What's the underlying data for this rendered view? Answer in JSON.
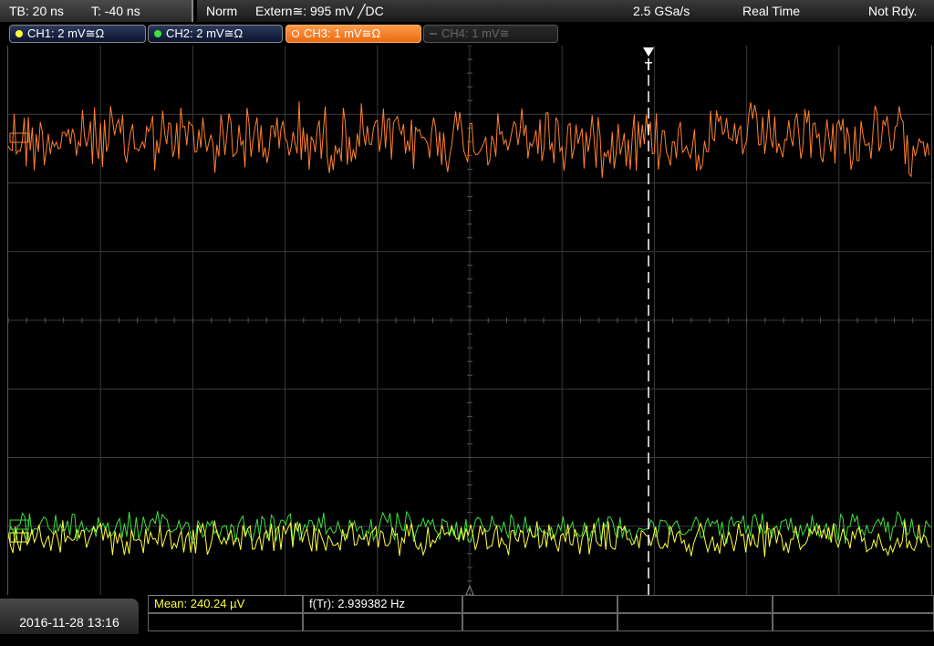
{
  "timebase": {
    "tb_label": "TB: 20 ns",
    "trigger_offset": "T: -40 ns"
  },
  "status": {
    "mode": "Norm",
    "trigger": "Extern≅: 995 mV ╱DC",
    "sample_rate": "2.5 GSa/s",
    "acquisition": "Real Time",
    "ready_state": "Not Rdy."
  },
  "channels": [
    {
      "label": "CH1: 2 mV≅Ω",
      "color": "#ffff40",
      "state": "on"
    },
    {
      "label": "CH2: 2 mV≅Ω",
      "color": "#40e040",
      "state": "on"
    },
    {
      "label": "CH3: 1 mV≅Ω",
      "color": "#ff8030",
      "state": "active"
    },
    {
      "label": "CH4: 1 mV≅",
      "color": "#666666",
      "state": "off"
    }
  ],
  "waveform_colors": {
    "ch1": "#ffff40",
    "ch2": "#40e040",
    "ch3": "#ff8030"
  },
  "trigger_marker": "T",
  "datetime": "2016-11-28 13:16",
  "measurements": {
    "mean": "Mean: 240.24 µV",
    "freq": "f(Tr): 2.939382 Hz"
  }
}
